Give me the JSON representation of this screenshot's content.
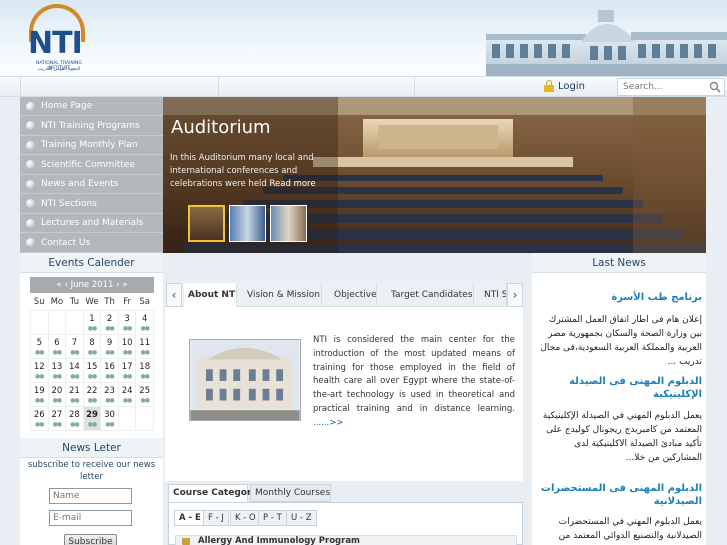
{
  "header": {
    "logo_text": "NTI",
    "logo_sub_en": "NATIONAL TRAINING INSTITUTE",
    "logo_sub_ar": "المعهد القومي للتدريب"
  },
  "topbar": {
    "login_label": "Login",
    "search_placeholder": "Search..."
  },
  "nav": {
    "items": [
      {
        "label": "Home Page"
      },
      {
        "label": "NTI Training Programs"
      },
      {
        "label": "Training Monthly Plan"
      },
      {
        "label": "Scientific Committee"
      },
      {
        "label": "News and Events"
      },
      {
        "label": "NTI Sections"
      },
      {
        "label": "Lectures and Materials"
      },
      {
        "label": "Contact Us"
      }
    ]
  },
  "hero": {
    "title": "Auditorium",
    "text": "In this Auditorium many local and international conferences and celebrations were held",
    "read_more": "Read more"
  },
  "calendar": {
    "title": "Events Calender",
    "prev_year": "«",
    "prev_month": "‹",
    "month": "June 2011",
    "next_month": "›",
    "next_year": "»",
    "weekdays": [
      "Su",
      "Mo",
      "Tu",
      "We",
      "Th",
      "Fr",
      "Sa"
    ],
    "weeks": [
      [
        "",
        "",
        "",
        "1",
        "2",
        "3",
        "4"
      ],
      [
        "5",
        "6",
        "7",
        "8",
        "9",
        "10",
        "11"
      ],
      [
        "12",
        "13",
        "14",
        "15",
        "16",
        "17",
        "18"
      ],
      [
        "19",
        "20",
        "21",
        "22",
        "23",
        "24",
        "25"
      ],
      [
        "26",
        "27",
        "28",
        "29",
        "30",
        "",
        ""
      ]
    ],
    "today": "29"
  },
  "newsletter": {
    "title": "News Leter",
    "subtitle": "subscribe to receive our news letter",
    "name_placeholder": "Name",
    "email_placeholder": "E-mail",
    "button_label": "Subscribe"
  },
  "tabs": {
    "prev": "‹",
    "next": "›",
    "items": [
      {
        "label": "About NTI",
        "active": true
      },
      {
        "label": "Vision & Mission",
        "active": false
      },
      {
        "label": "Objective",
        "active": false
      },
      {
        "label": "Target Candidates",
        "active": false
      },
      {
        "label": "NTI Se",
        "active": false
      }
    ],
    "about_text": "NTI is considered the main center for the introduction of the most updated means of training for those employed in the field of health care all over Egypt where the state-of-the-art technology is used in theoretical and practical training and in distance learning.",
    "about_more": "......>>"
  },
  "courses": {
    "tabs": [
      "Course Category",
      "Monthly Courses"
    ],
    "alpha_tabs": [
      "A - E",
      "F - J",
      "K - O",
      "P - T",
      "U - Z"
    ],
    "first_row": "Allergy And Immunology Program"
  },
  "last_news": {
    "title": "Last News",
    "items": [
      {
        "title": "برنامج طب الأسرة",
        "body": "إعلان هام فى اطار اتفاق العمل المشترك بين وزارة الصحة والسكان بجمهورية مصر العربية والمملكة العربية السعودية،فى مجال تدريب ..."
      },
      {
        "title": "الدبلوم المهنى فى الصيدلة الإكلينيكية",
        "body": "يعمل الدبلوم المهني في الصيدلة الإكلينيكية المعتمد من كامبريدج ريجونال كوليدج على تأكيد مبادئ الصيدلة الاكلينيكية لدى المشاركين من خلا..."
      },
      {
        "title": "الدبلوم المهنى فى المستحضرات الصيدلانية",
        "body": "يعمل الدبلوم المهني في المستحضرات الصيدلانية والتصنيع الدوائي المعتمد من كامبريدج ريجونال كوليدج"
      }
    ]
  },
  "colors": {
    "nav_bg": "#b4b8bc",
    "link_blue": "#1c7fb8",
    "logo_blue": "#1d4f8c",
    "logo_orange": "#d08a2a"
  }
}
